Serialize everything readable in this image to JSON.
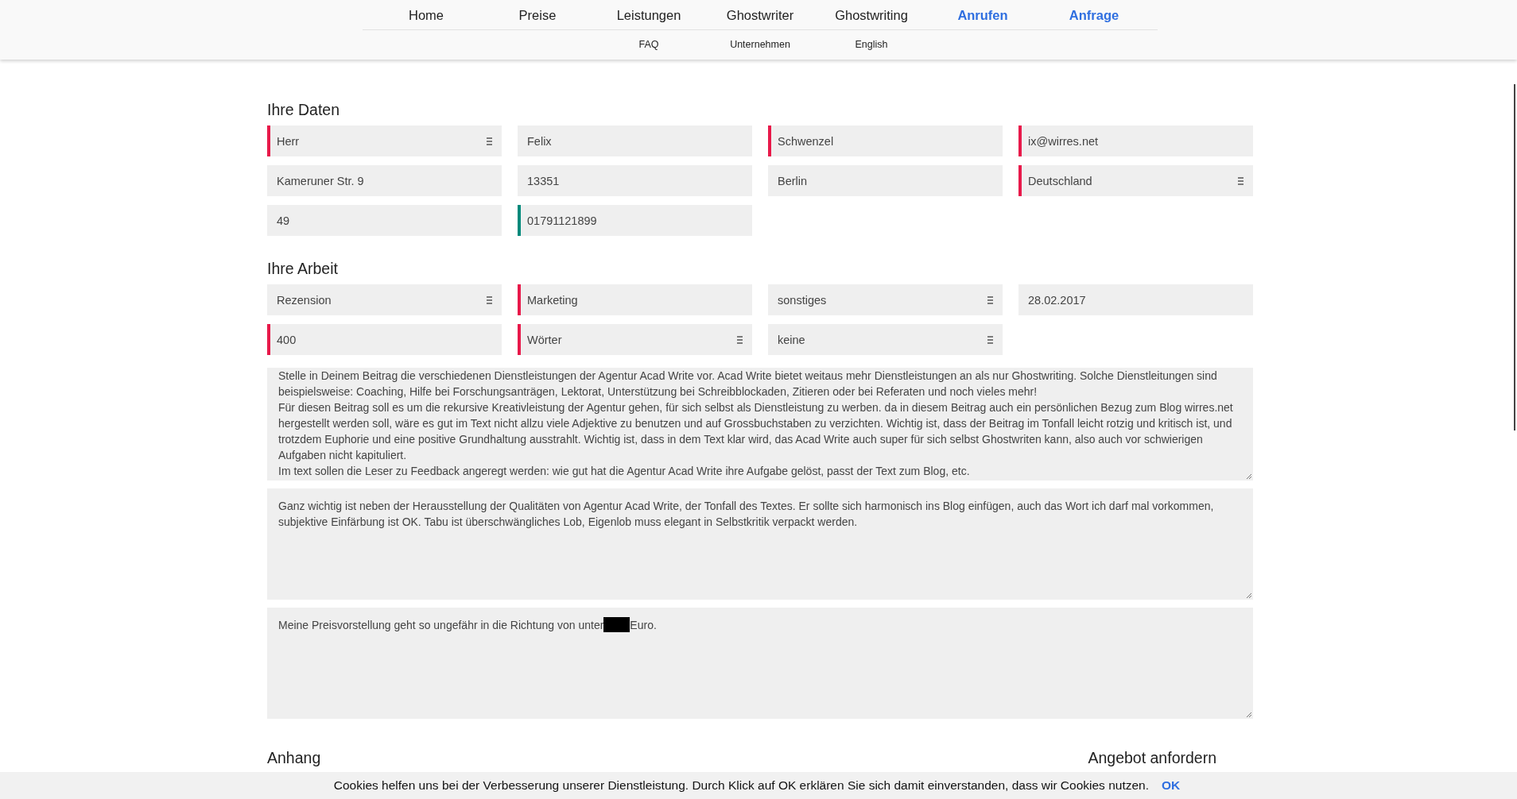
{
  "nav": {
    "primary": [
      {
        "label": "Home",
        "kind": "link"
      },
      {
        "label": "Preise",
        "kind": "link"
      },
      {
        "label": "Leistungen",
        "kind": "link"
      },
      {
        "label": "Ghostwriter",
        "kind": "link"
      },
      {
        "label": "Ghostwriting",
        "kind": "link"
      },
      {
        "label": "Anrufen",
        "kind": "cta"
      },
      {
        "label": "Anfrage",
        "kind": "cta"
      }
    ],
    "secondary": [
      {
        "label": "FAQ"
      },
      {
        "label": "Unternehmen"
      },
      {
        "label": "English"
      }
    ]
  },
  "sections": [
    {
      "title": "Ihre Daten",
      "rows": [
        [
          {
            "value": "Herr",
            "kind": "select",
            "color": "#e8194a"
          },
          {
            "value": "Felix",
            "kind": "text"
          },
          {
            "value": "Schwenzel",
            "kind": "text",
            "color": "#e8194a"
          },
          {
            "value": "ix@wirres.net",
            "kind": "text",
            "color": "#e8194a"
          }
        ],
        [
          {
            "value": "Kameruner Str. 9",
            "kind": "text"
          },
          {
            "value": "13351",
            "kind": "text"
          },
          {
            "value": "Berlin",
            "kind": "text"
          },
          {
            "value": "Deutschland",
            "kind": "select",
            "color": "#e8194a"
          }
        ],
        [
          {
            "value": "49",
            "kind": "text"
          },
          {
            "value": "01791121899",
            "kind": "text",
            "color": "#00897b"
          }
        ]
      ]
    },
    {
      "title": "Ihre Arbeit",
      "rows": [
        [
          {
            "value": "Rezension",
            "kind": "select"
          },
          {
            "value": "Marketing",
            "kind": "text",
            "color": "#e8194a"
          },
          {
            "value": "sonstiges",
            "kind": "select"
          },
          {
            "value": "28.02.2017",
            "kind": "text"
          }
        ],
        [
          {
            "value": "400",
            "kind": "text",
            "color": "#e8194a"
          },
          {
            "value": "Wörter",
            "kind": "select",
            "color": "#e8194a"
          },
          {
            "value": "keine",
            "kind": "select"
          }
        ]
      ]
    }
  ],
  "textareas": [
    {
      "value": "Stelle in Deinem Beitrag die verschiedenen Dienstleistungen der Agentur Acad Write vor. Acad Write bietet weitaus mehr Dienstleistungen an als nur Ghostwriting. Solche Dienstleitungen sind beispielsweise: Coaching, Hilfe bei Forschungsanträgen, Lektorat, Unterstützung bei Schreibblockaden, Zitieren oder bei Referaten und noch vieles mehr!\nFür diesen Beitrag soll es um die rekursive Kreativleistung der Agentur gehen, für sich selbst als Dienstleistung zu werben. da in diesem Beitrag auch ein persönlichen Bezug zum Blog wirres.net hergestellt werden soll, wäre es gut im Text nicht allzu viele Adjektive zu benutzen und auf Grossbuchstaben zu verzichten. Wichtig ist, dass der Beitrag im Tonfall leicht rotzig und kritisch ist, und trotzdem Euphorie und eine positive Grundhaltung ausstrahlt. Wichtig ist, dass in dem Text klar wird, das Acad Write auch super für sich selbst Ghostwriten kann, also auch vor schwierigen Aufgaben nicht kapituliert.\nIm text sollen die Leser zu Feedback angeregt werden: wie gut hat die Agentur Acad Write ihre Aufgabe gelöst, passt der Text zum Blog, etc.",
      "redacted": false
    },
    {
      "value": "Ganz wichtig ist neben der Herausstellung der Qualitäten von Agentur Acad Write, der Tonfall des Textes. Er sollte sich harmonisch ins Blog einfügen, auch das Wort ich darf mal vorkommen, subjektive Einfärbung ist OK. Tabu ist überschwängliches Lob, Eigenlob muss elegant in Selbstkritik verpackt werden.",
      "redacted": false
    },
    {
      "value": "Meine Preisvorstellung geht so ungefähr in die Richtung von unter",
      "after": "Euro.",
      "redacted": true
    }
  ],
  "footer_headings": [
    "Anhang",
    "Angebot anfordern"
  ],
  "cookie_bar": {
    "text": "Cookies helfen uns bei der Verbesserung unserer Dienstleistung. Durch Klick auf OK erklären Sie sich damit einverstanden, dass wir Cookies nutzen.",
    "button": "OK"
  }
}
